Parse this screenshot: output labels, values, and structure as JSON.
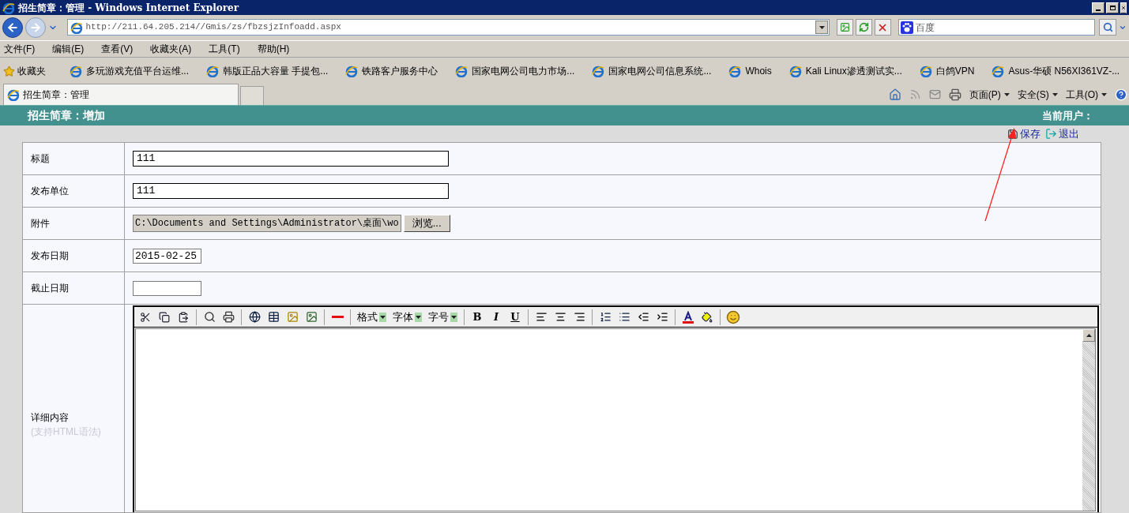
{
  "window": {
    "title": "招生简章：管理 - Windows Internet Explorer"
  },
  "address_bar": {
    "url": "http://211.64.205.214//Gmis/zs/fbzsjzInfoadd.aspx"
  },
  "search": {
    "value": "百度"
  },
  "menu": [
    "文件(F)",
    "编辑(E)",
    "查看(V)",
    "收藏夹(A)",
    "工具(T)",
    "帮助(H)"
  ],
  "favorites": {
    "label": "收藏夹",
    "links": [
      "多玩游戏充值平台运维...",
      "韩版正品大容量 手提包...",
      "铁路客户服务中心",
      "国家电网公司电力市场...",
      "国家电网公司信息系统...",
      "Whois",
      "Kali Linux渗透测试实...",
      "白鸽VPN",
      "Asus-华硕 N56XI361VZ-..."
    ]
  },
  "tabs": [
    {
      "label": "招生简章：管理",
      "selected": true
    }
  ],
  "command_bar": [
    "页面(P)",
    "安全(S)",
    "工具(O)"
  ],
  "page": {
    "title": "招生简章：增加",
    "user_label": "当前用户：",
    "actions": [
      {
        "kind": "save",
        "label": "保存"
      },
      {
        "kind": "exit",
        "label": "退出"
      }
    ],
    "rows": [
      {
        "kind": "text",
        "label": "标题",
        "value": "111"
      },
      {
        "kind": "text",
        "label": "发布单位",
        "value": "111"
      },
      {
        "kind": "file",
        "label": "附件",
        "value": "C:\\Documents and Settings\\Administrator\\桌面\\wo",
        "button": "浏览..."
      },
      {
        "kind": "date",
        "label": "发布日期",
        "value": "2015-02-25"
      },
      {
        "kind": "date",
        "label": "截止日期"
      }
    ],
    "editor": {
      "label": "详细内容",
      "hint": "(支持HTML语法)",
      "dropdowns": [
        "格式",
        "字体",
        "字号"
      ],
      "format_buttons": [
        "B",
        "I",
        "U"
      ]
    }
  }
}
